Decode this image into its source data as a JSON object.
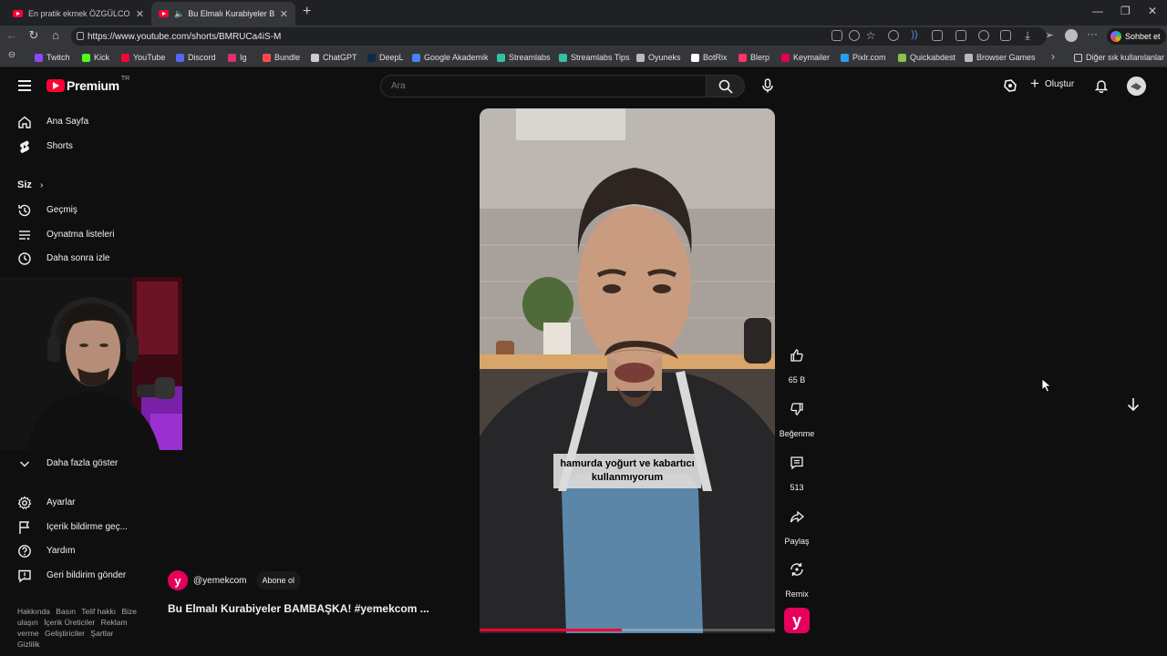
{
  "browser": {
    "tabs": [
      {
        "title": "En pratik ekmek ÖZGÜLCOŞAR",
        "active": false
      },
      {
        "title": "Bu Elmalı Kurabiyeler BAMBAŞ",
        "active": true
      }
    ],
    "url": "https://www.youtube.com/shorts/BMRUCa4iS-M",
    "sohbet_label": "Sohbet et",
    "bookmarks": [
      "Twitch",
      "Kick",
      "YouTube",
      "Discord",
      "Ig",
      "Bundle",
      "ChatGPT",
      "DeepL",
      "Google Akademik",
      "Streamlabs",
      "Streamlabs Tips",
      "Oyuneks",
      "BotRix",
      "Blerp",
      "Keymailer",
      "Pixlr.com",
      "Quickabdest",
      "Browser Games"
    ],
    "bookmark_colors": [
      "#9146ff",
      "#53fc18",
      "#ff0033",
      "#5865f2",
      "#e1306c",
      "#ff4b4b",
      "#cccccc",
      "#0f2b46",
      "#4285f4",
      "#31c3a2",
      "#31c3a2",
      "#bbbbbb",
      "#ffffff",
      "#ff3366",
      "#e5004f",
      "#2a9df4",
      "#8bc34a",
      "#bbbbbb"
    ],
    "other_bookmarks": "Diğer sık kullanılanlar"
  },
  "youtube": {
    "logo_text": "Premium",
    "region": "TR",
    "search_placeholder": "Ara",
    "create_label": "Oluştur",
    "sidebar": {
      "primary": [
        {
          "label": "Ana Sayfa",
          "icon": "home-icon"
        },
        {
          "label": "Shorts",
          "icon": "shorts-icon"
        }
      ],
      "you_heading": "Siz",
      "you_items": [
        {
          "label": "Geçmiş",
          "icon": "history-icon"
        },
        {
          "label": "Oynatma listeleri",
          "icon": "playlists-icon"
        },
        {
          "label": "Daha sonra izle",
          "icon": "watch-later-icon"
        }
      ],
      "show_more": "Daha fazla göster",
      "settings_items": [
        {
          "label": "Ayarlar",
          "icon": "settings-icon"
        },
        {
          "label": "İçerik bildirme geç...",
          "icon": "flag-icon"
        },
        {
          "label": "Yardım",
          "icon": "help-icon"
        },
        {
          "label": "Geri bildirim gönder",
          "icon": "feedback-icon"
        }
      ],
      "footer_links": [
        "Hakkında",
        "Basın",
        "Telif hakkı",
        "Bize ulaşın",
        "İçerik Üreticiler",
        "Reklam verme",
        "Geliştiriciler",
        "Şartlar",
        "Gizlilik"
      ]
    },
    "short": {
      "caption": "hamurda yoğurt ve kabartıcı kullanmıyorum",
      "channel": "@yemekcom",
      "subscribe": "Abone ol",
      "title": "Bu Elmalı Kurabiyeler BAMBAŞKA! #yemekcom ...",
      "progress": 0.48,
      "actions": {
        "like_count": "65 B",
        "dislike_label": "Beğenme",
        "comment_count": "513",
        "share_label": "Paylaş",
        "remix_label": "Remix"
      }
    },
    "colors": {
      "brand_red": "#ff0033",
      "channel_pink": "#e6005c"
    }
  }
}
